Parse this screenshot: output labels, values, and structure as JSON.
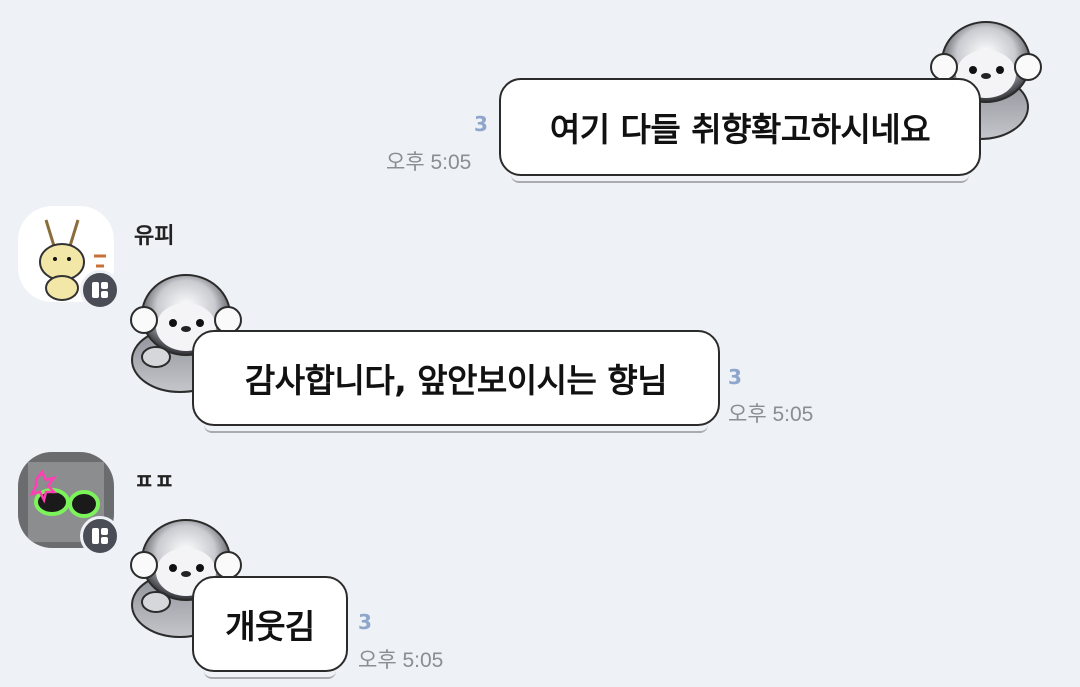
{
  "messages": [
    {
      "sender": "",
      "text": "여기 다들 취향확고하시네요",
      "unread": "3",
      "time": "오후 5:05",
      "sticker_icon": "penguin-sticker"
    },
    {
      "sender": "유피",
      "text": "감사합니다, 앞안보이시는 향님",
      "unread": "3",
      "time": "오후 5:05",
      "sticker_icon": "penguin-sticker",
      "avatar_icon": "rabbit-avatar",
      "badge_icon": "profile-badge-icon"
    },
    {
      "sender": "ㅍㅍ",
      "text": "개웃김",
      "unread": "3",
      "time": "오후 5:05",
      "sticker_icon": "penguin-sticker",
      "avatar_icon": "sunglasses-avatar",
      "badge_icon": "profile-badge-icon"
    }
  ],
  "colors": {
    "background": "#eef1f6",
    "unread": "#8ea6cc",
    "time": "#8a8d93",
    "bubble_border": "#2b2b2b"
  }
}
